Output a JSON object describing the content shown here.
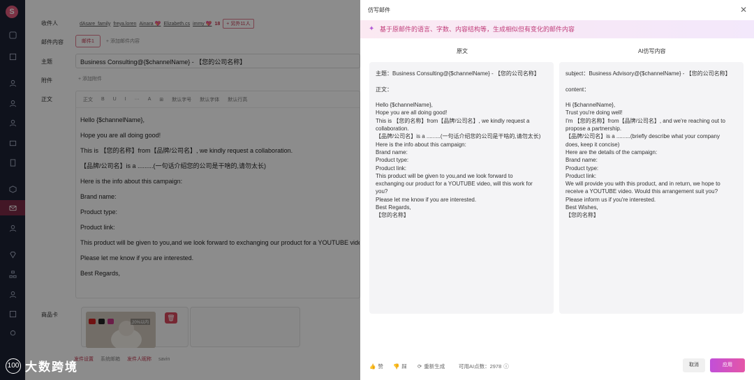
{
  "form": {
    "recipients_label": "收件人",
    "recipients": [
      "dAsare_family",
      "freya.loren",
      "Ainara 💖",
      "Elizabeth.cs",
      "immy 💖"
    ],
    "recipient_count": "18",
    "more_label": "+ 另外11人",
    "content_label": "邮件内容",
    "mail_tab": "邮件1",
    "add_mail": "+  添加邮件内容",
    "subject_label": "主题",
    "subject_value": "Business Consulting@{$channelName} - 【您的公司名称】",
    "attachment_label": "附件",
    "add_attachment": "+ 添加附件",
    "body_label": "正文",
    "toolbar": [
      "正文",
      "B",
      "U",
      "I",
      "···",
      "A",
      "⊞",
      "默认字号",
      "默认字体",
      "默认行高"
    ],
    "body_lines": [
      "Hello {$channelName},",
      "Hope you are all doing good!",
      "This is 【您的名称】from【品牌/公司名】, we kindly request a collaboration.",
      "【品牌/公司名】is a .........(一句话介绍您的公司是干啥的,请勿太长)",
      "Here is the info about this campaign:",
      "Brand name:",
      "Product type:",
      "Product link:",
      "This product will be given to you,and we look forward to exchanging our product for a YOUTUBE video, will this work for you?",
      "Please let me know if you are interested.",
      "Best Regards,"
    ],
    "product_card_label": "商品卡",
    "card_badge": "20%以内",
    "footer": [
      "发件设置",
      "系统邮箱",
      "发件人昵称",
      "savin"
    ]
  },
  "watermark": {
    "logo": "100",
    "text": "大数跨境"
  },
  "drawer": {
    "title": "仿写邮件",
    "banner": "基于原邮件的语言、字数、内容结构等，生成相似但有变化的邮件内容",
    "original_title": "原文",
    "ai_title": "AI仿写内容",
    "original_lines": [
      "主题：Business Consulting@{$channelName} - 【您的公司名称】",
      "",
      "正文：",
      "",
      "Hello {$channelName},",
      "Hope you are all doing good!",
      "This is 【您的名称】from【品牌/公司名】, we kindly request a",
      "collaboration.",
      "【品牌/公司名】is a .........(一句话介绍您的公司是干啥的,请勿太长)",
      "Here is the info about this campaign:",
      "Brand name:",
      "Product type:",
      "Product link:",
      "This product will be given to you,and we look forward to",
      "exchanging our product for a YOUTUBE video, will this work for",
      "you?",
      "Please let me know if you are interested.",
      "Best Regards,",
      "【您的名称】"
    ],
    "ai_lines": [
      "subject：Business Advisory@{$channelName} - 【您的公司名称】",
      "",
      "content：",
      "",
      "Hi {$channelName},",
      "Trust you're doing well!",
      "I'm 【您的名称】from【品牌/公司名】, and we're reaching out to",
      "propose a partnership.",
      "【品牌/公司名】is a .........(briefly describe what your company",
      "does, keep it concise)",
      "Here are the details of the campaign:",
      "Brand name:",
      "Product type:",
      "Product link:",
      "We will provide you with this product, and in return, we hope to",
      "receive a YOUTUBE video. Would this arrangement suit you?",
      "Please inform us if you're interested.",
      "Best Wishes,",
      "【您的名称】"
    ],
    "like": "赞",
    "dislike": "踩",
    "regenerate": "重新生成",
    "credits": "可用AI点数：2978",
    "cancel": "取消",
    "apply": "应用"
  }
}
